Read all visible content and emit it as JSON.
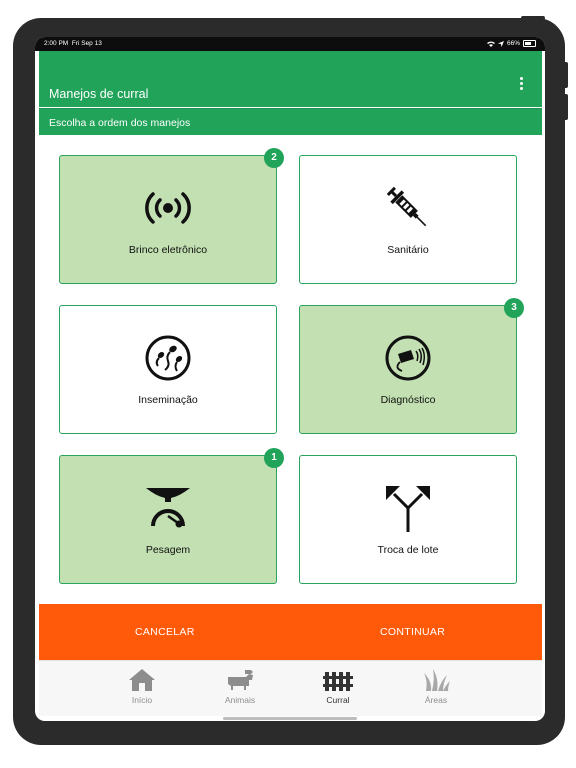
{
  "status_bar": {
    "time": "2:00 PM",
    "date": "Fri Sep 13",
    "battery": "66%"
  },
  "header": {
    "title": "Manejos de curral",
    "subtitle": "Escolha a ordem dos manejos"
  },
  "cards": [
    {
      "label": "Brinco eletrônico",
      "selected": true,
      "badge": "2",
      "icon": "rfid-signal-icon"
    },
    {
      "label": "Sanitário",
      "selected": false,
      "badge": "",
      "icon": "syringe-icon"
    },
    {
      "label": "Inseminação",
      "selected": false,
      "badge": "",
      "icon": "sperm-icon"
    },
    {
      "label": "Diagnóstico",
      "selected": true,
      "badge": "3",
      "icon": "ultrasound-probe-icon"
    },
    {
      "label": "Pesagem",
      "selected": true,
      "badge": "1",
      "icon": "scale-icon"
    },
    {
      "label": "Troca de lote",
      "selected": false,
      "badge": "",
      "icon": "split-arrows-icon"
    }
  ],
  "actions": {
    "cancel": "CANCELAR",
    "continue": "CONTINUAR"
  },
  "nav": [
    {
      "label": "Início",
      "icon": "house-icon",
      "active": false
    },
    {
      "label": "Animais",
      "icon": "animals-icon",
      "active": false
    },
    {
      "label": "Curral",
      "icon": "fence-icon",
      "active": true
    },
    {
      "label": "Áreas",
      "icon": "grass-icon",
      "active": false
    }
  ],
  "colors": {
    "primary": "#21a35a",
    "selected_card": "#c2e0b1",
    "action": "#ff5a0a"
  }
}
